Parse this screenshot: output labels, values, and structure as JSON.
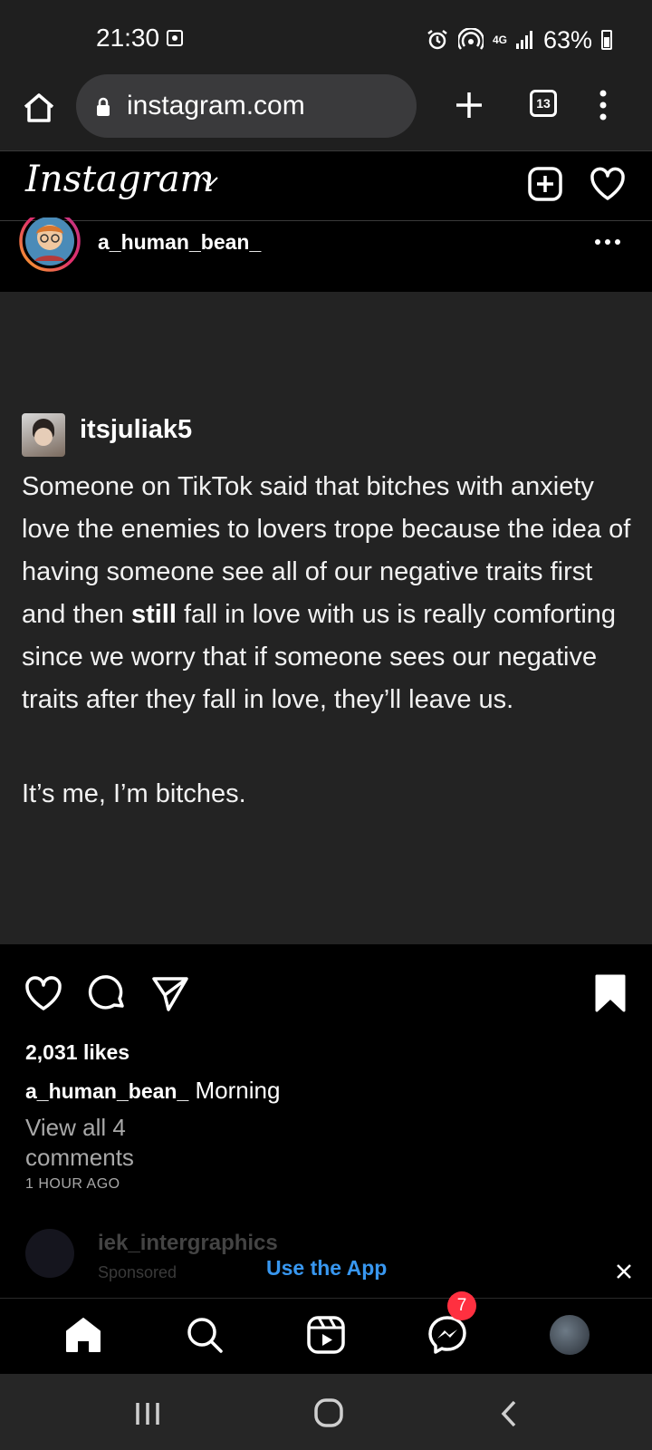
{
  "status_bar": {
    "time": "21:30",
    "network": "4G",
    "battery": "63%"
  },
  "browser": {
    "url": "instagram.com",
    "tab_count": "13"
  },
  "ig_header": {
    "logo": "Instagram"
  },
  "post": {
    "username": "a_human_bean_",
    "quote": {
      "username": "itsjuliak5",
      "text_before_bold": "Someone on TikTok said that bitches with anxiety love the enemies to lovers trope because the idea of having someone see all of our negative traits first and then ",
      "text_bold": "still",
      "text_after_bold": " fall in love with us is really comforting since we worry that if someone sees our negative traits after they fall in love, they’ll leave us.",
      "sign_off": "It’s me, I’m bitches."
    },
    "likes": "2,031 likes",
    "caption_user": "a_human_bean_",
    "caption_text": "Morning",
    "view_comments": "View all 4 comments",
    "time": "1 HOUR AGO"
  },
  "sponsored": {
    "name": "iek_intergraphics",
    "label": "Sponsored"
  },
  "banner": {
    "use_app": "Use the App"
  },
  "bottom_nav": {
    "messenger_badge": "7"
  },
  "colors": {
    "link": "#3897f0",
    "badge": "#ff3040",
    "post_bg": "#232323"
  }
}
